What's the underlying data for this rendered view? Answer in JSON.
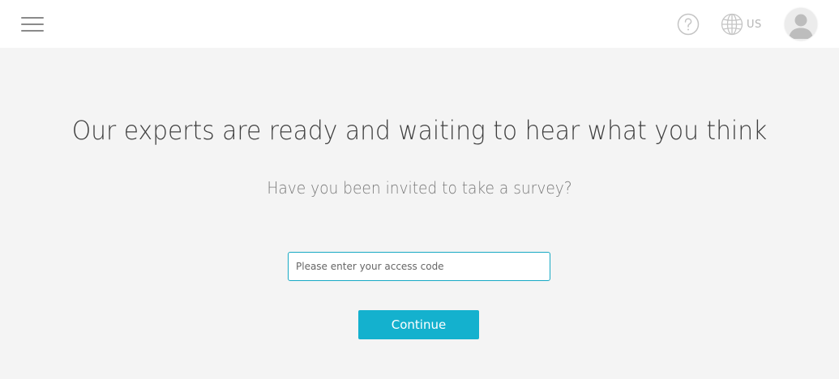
{
  "header": {
    "menu_icon": "hamburger-menu-icon",
    "help_icon": "question-circle-icon",
    "language_icon": "globe-icon",
    "language_label": "US",
    "avatar_icon": "user-avatar-icon"
  },
  "main": {
    "headline": "Our experts are ready and waiting to hear what you think",
    "subheadline": "Have you been invited to take a survey?",
    "access_code_placeholder": "Please enter your access code",
    "access_code_value": "",
    "continue_label": "Continue"
  },
  "colors": {
    "accent": "#14b1ce",
    "input_border": "#17a9c4",
    "page_background": "#f4f4f4",
    "header_background": "#ffffff"
  }
}
